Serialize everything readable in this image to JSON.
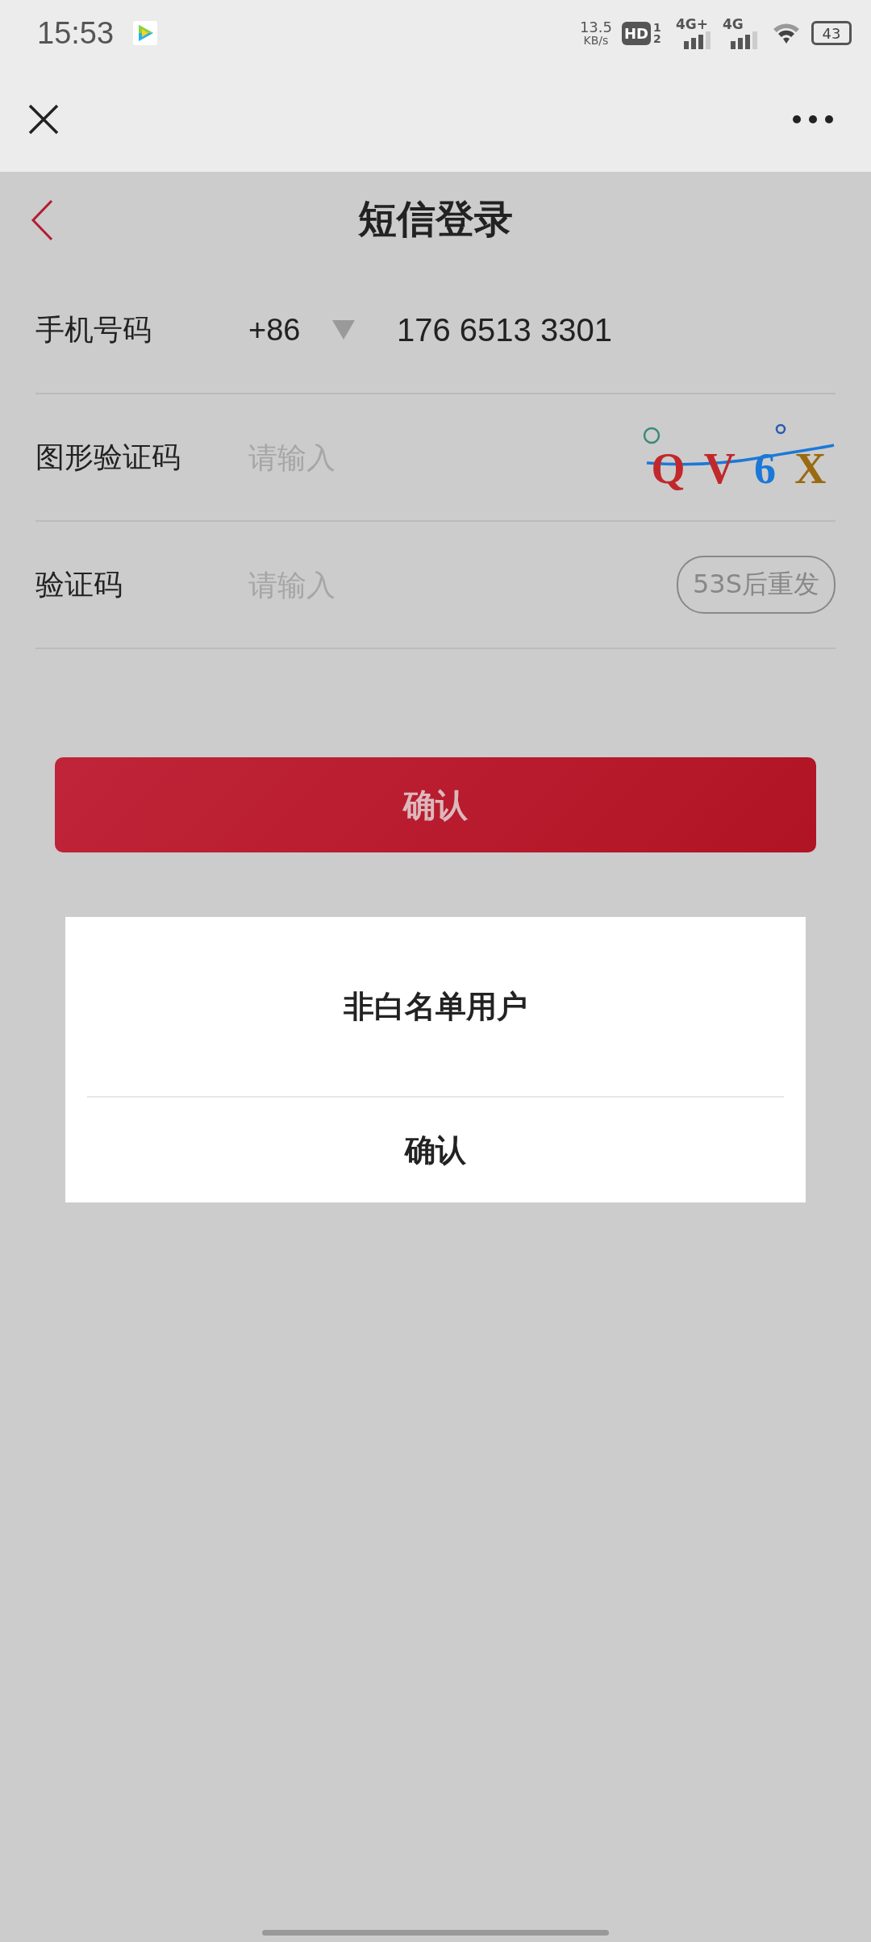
{
  "status_bar": {
    "time": "15:53",
    "speed": "13.5",
    "speed_unit": "KB/s",
    "hd": "HD",
    "sim_slots": "1 2",
    "network_1": "4G+",
    "network_2": "4G",
    "battery": "43"
  },
  "header": {
    "title": "短信登录"
  },
  "form": {
    "phone": {
      "label": "手机号码",
      "country_code": "+86",
      "value": "176 6513 3301"
    },
    "captcha": {
      "label": "图形验证码",
      "placeholder": "请输入",
      "chars": [
        {
          "char": "Q",
          "color": "#c0282c"
        },
        {
          "char": "V",
          "color": "#c0282c"
        },
        {
          "char": "6",
          "color": "#1c78d8"
        },
        {
          "char": "X",
          "color": "#9a6a10"
        }
      ]
    },
    "sms_code": {
      "label": "验证码",
      "placeholder": "请输入",
      "resend": "53S后重发"
    }
  },
  "confirm_button": "确认",
  "dialog": {
    "message": "非白名单用户",
    "button": "确认"
  }
}
